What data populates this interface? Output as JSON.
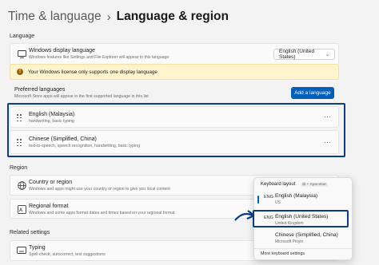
{
  "breadcrumb": {
    "parent": "Time & language",
    "separator": "›",
    "current": "Language & region"
  },
  "language_section": {
    "heading": "Language",
    "display_language": {
      "title": "Windows display language",
      "subtitle": "Windows features like Settings and File Explorer will appear in this language",
      "value": "English (United States)"
    },
    "license_notice": "Your Windows license only supports one display language",
    "preferred": {
      "title": "Preferred languages",
      "subtitle": "Microsoft Store apps will appear in the first supported language in this list",
      "add_button": "Add a language"
    },
    "languages": [
      {
        "name": "English (Malaysia)",
        "features": "handwriting, basic typing",
        "more": "···"
      },
      {
        "name": "Chinese (Simplified, China)",
        "features": "text-to-speech, speech recognition, handwriting, basic typing",
        "more": "···"
      }
    ]
  },
  "region_section": {
    "heading": "Region",
    "country": {
      "title": "Country or region",
      "subtitle": "Windows and apps might use your country or region to give you local content"
    },
    "format": {
      "title": "Regional format",
      "subtitle": "Windows and some apps format dates and times based on your regional format"
    }
  },
  "related_section": {
    "heading": "Related settings",
    "typing": {
      "title": "Typing",
      "subtitle": "Spell check, autocorrect, text suggestions"
    }
  },
  "keyboard_flyout": {
    "title": "Keyboard layout",
    "shortcut": "⊞ + Spacebar",
    "items": [
      {
        "code": "ENG",
        "name": "English (Malaysia)",
        "sub": "US",
        "active": true
      },
      {
        "code": "ENG",
        "name": "English (United States)",
        "sub": "United Kingdom",
        "active": false
      },
      {
        "code": "",
        "name": "Chinese (Simplified, China)",
        "sub": "Microsoft Pinyin",
        "active": false
      }
    ],
    "more_settings": "More keyboard settings"
  },
  "colors": {
    "accent": "#005fb8",
    "highlight": "#0b3c8c",
    "warning_bg": "#fff4ce",
    "warning_icon": "#9d5d00"
  }
}
